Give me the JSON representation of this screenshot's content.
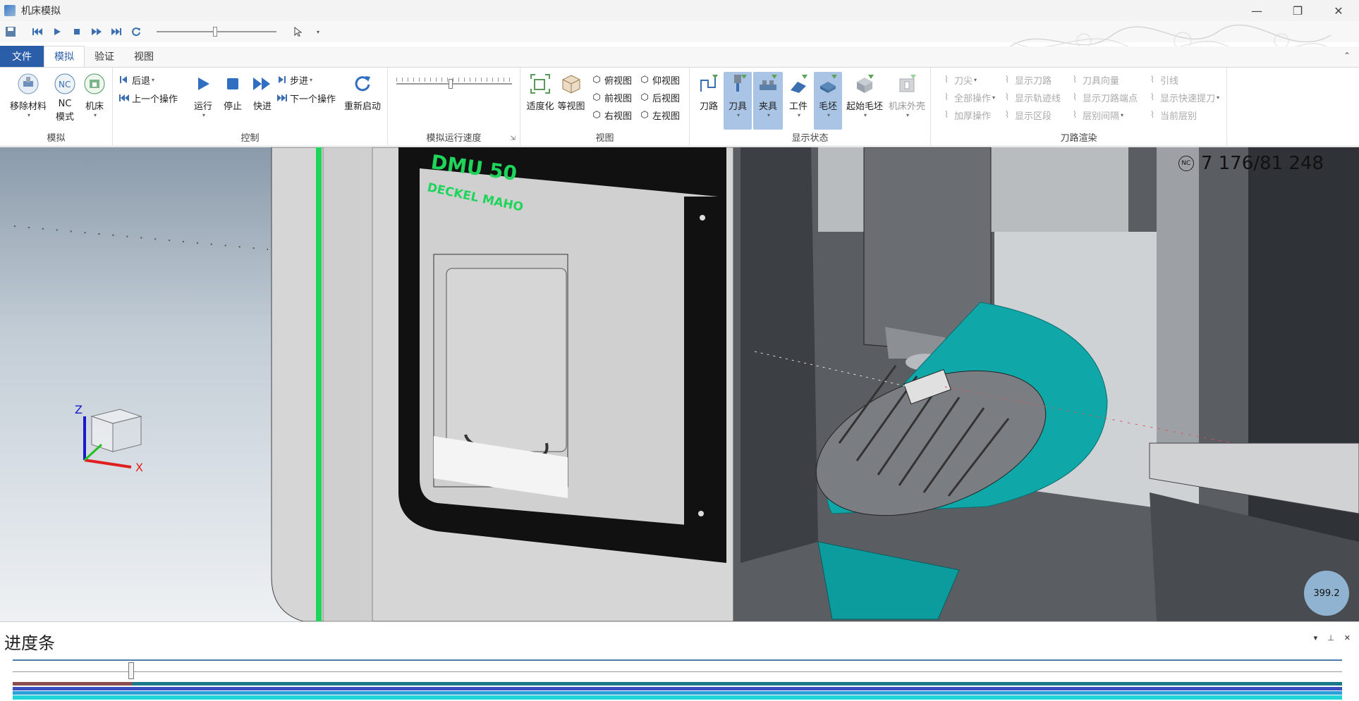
{
  "window": {
    "title": "机床模拟",
    "minimize": "—",
    "maximize": "❐",
    "close": "✕"
  },
  "qat": {
    "icons": [
      "save-icon",
      "first-icon",
      "play-icon",
      "stop-icon",
      "fast-forward-icon",
      "last-icon",
      "restart-icon",
      "cursor-icon",
      "more-icon"
    ],
    "speed_level": 0.47
  },
  "tabs": [
    {
      "label": "文件"
    },
    {
      "label": "模拟"
    },
    {
      "label": "验证"
    },
    {
      "label": "视图"
    }
  ],
  "ribbon": {
    "groups": {
      "sim": {
        "label": "模拟",
        "remove": "移除材料",
        "nc_line1": "NC",
        "nc_line2": "模式",
        "machine": "机床"
      },
      "control": {
        "label": "控制",
        "back": "后退",
        "prev": "上一个操作",
        "run": "运行",
        "stop": "停止",
        "fast": "快进",
        "step": "步进",
        "next": "下一个操作",
        "restart": "重新启动"
      },
      "speed": {
        "label": "模拟运行速度",
        "level": 0.47
      },
      "view": {
        "label": "视图",
        "fit": "适度化",
        "iso": "等视图",
        "top": "俯视图",
        "bottom": "仰视图",
        "front": "前视图",
        "back": "后视图",
        "right": "右视图",
        "left": "左视图"
      },
      "display": {
        "label": "显示状态",
        "toolpath": "刀路",
        "tool": "刀具",
        "fixture": "夹具",
        "workpiece": "工件",
        "stock": "毛坯",
        "initial_stock": "起始毛坯",
        "housing": "机床外壳"
      },
      "render": {
        "label": "刀路渲染",
        "col1": [
          "刀尖",
          "全部操作",
          "加厚操作"
        ],
        "col2": [
          "显示刀路",
          "显示轨迹线",
          "显示区段"
        ],
        "col3": [
          "刀具向量",
          "显示刀路端点",
          "层别间隔"
        ],
        "col4": [
          "引线",
          "显示快速提刀",
          "当前层别"
        ]
      }
    }
  },
  "viewport": {
    "nc_badge": "NC",
    "counter": "7 176/81 248",
    "machine_brand_1": "DMU 50",
    "machine_brand_2": "DECKEL MAHO",
    "axis_z": "Z",
    "axis_x": "X",
    "speed_value": "399.2"
  },
  "progress": {
    "title": "进度条",
    "position": 0.087
  }
}
